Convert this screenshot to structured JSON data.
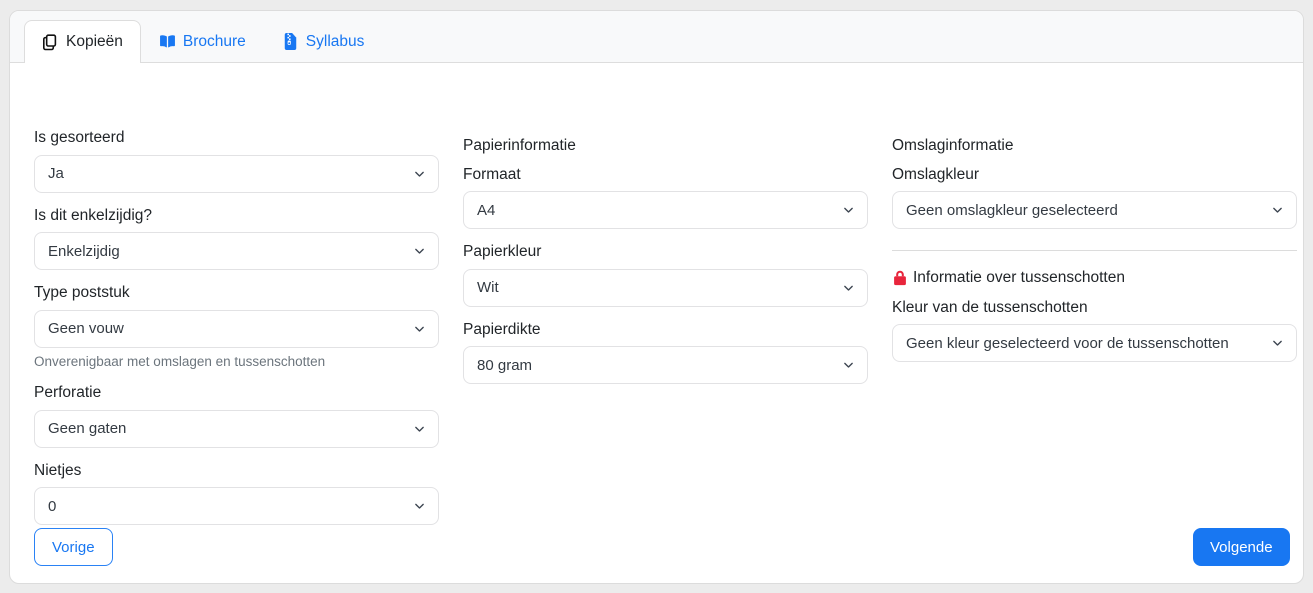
{
  "tabs": [
    {
      "label": "Kopieën",
      "icon": "copy-icon",
      "active": true
    },
    {
      "label": "Brochure",
      "icon": "book-open-icon",
      "active": false
    },
    {
      "label": "Syllabus",
      "icon": "file-zipper-icon",
      "active": false
    }
  ],
  "columns": {
    "left": {
      "fields": [
        {
          "label": "Is gesorteerd",
          "value": "Ja",
          "helper": ""
        },
        {
          "label": "Is dit enkelzijdig?",
          "value": "Enkelzijdig",
          "helper": ""
        },
        {
          "label": "Type poststuk",
          "value": "Geen vouw",
          "helper": "Onverenigbaar met omslagen en tussenschotten"
        },
        {
          "label": "Perforatie",
          "value": "Geen gaten",
          "helper": ""
        },
        {
          "label": "Nietjes",
          "value": "0",
          "helper": ""
        }
      ]
    },
    "middle": {
      "section_title": "Papierinformatie",
      "fields": [
        {
          "label": "Formaat",
          "value": "A4"
        },
        {
          "label": "Papierkleur",
          "value": "Wit"
        },
        {
          "label": "Papierdikte",
          "value": "80 gram"
        }
      ]
    },
    "right": {
      "section_title": "Omslaginformatie",
      "fields": [
        {
          "label": "Omslagkleur",
          "value": "Geen omslagkleur geselecteerd"
        }
      ],
      "locked_section": {
        "icon": "lock-icon",
        "title": "Informatie over tussenschotten",
        "fields": [
          {
            "label": "Kleur van de tussenschotten",
            "value": "Geen kleur geselecteerd voor de tussenschotten"
          }
        ]
      }
    }
  },
  "footer": {
    "prev_label": "Vorige",
    "next_label": "Volgende"
  },
  "colors": {
    "accent": "#1877f2",
    "lock_red": "#e8253c",
    "page_bg": "#ececec",
    "tabstrip_bg": "#f8f9fa",
    "border": "#dcdcdc",
    "helper_text": "#6c757d"
  }
}
